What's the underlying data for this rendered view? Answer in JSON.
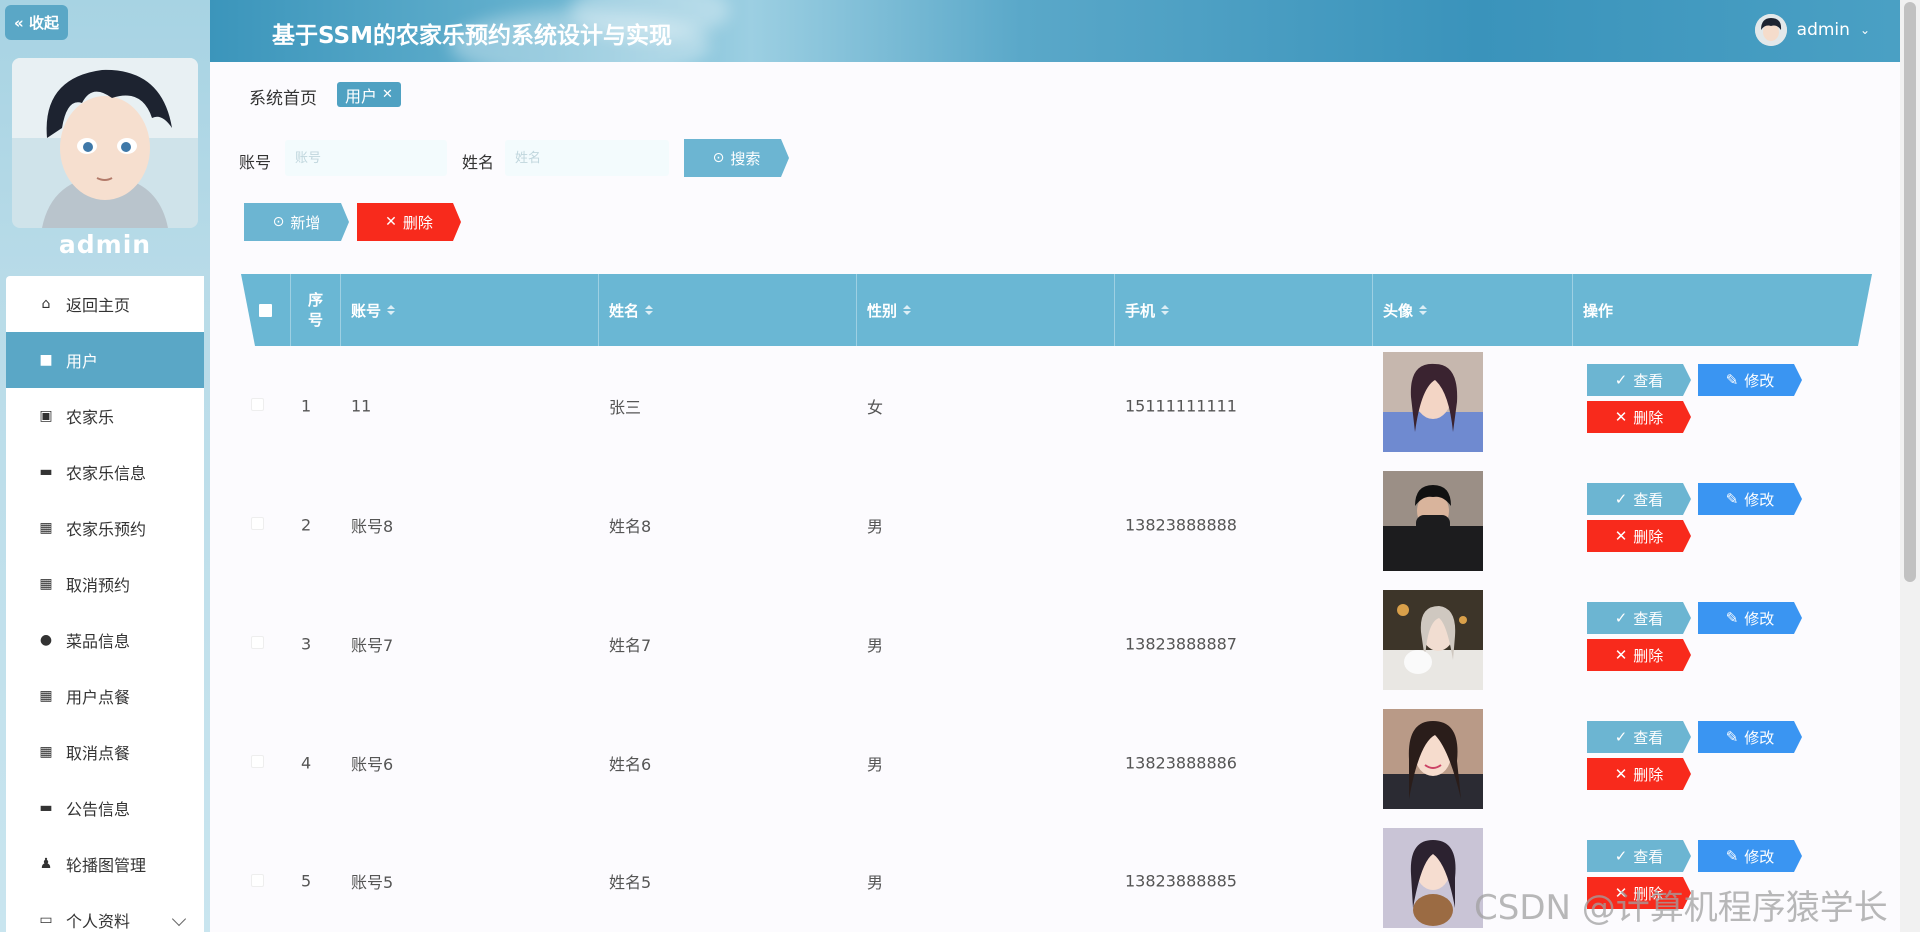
{
  "sidebar": {
    "collapse_label": "« 收起",
    "username": "admin",
    "menu": [
      {
        "label": "返回主页",
        "icon": "home-icon",
        "glyph": "⌂"
      },
      {
        "label": "用户",
        "icon": "user-thumb-icon",
        "glyph": "■"
      },
      {
        "label": "农家乐",
        "icon": "chart-icon",
        "glyph": "▣"
      },
      {
        "label": "农家乐信息",
        "icon": "monitor-icon",
        "glyph": "▬"
      },
      {
        "label": "农家乐预约",
        "icon": "grid-icon",
        "glyph": "▦"
      },
      {
        "label": "取消预约",
        "icon": "grid-icon",
        "glyph": "▦"
      },
      {
        "label": "菜品信息",
        "icon": "bulb-icon",
        "glyph": "●"
      },
      {
        "label": "用户点餐",
        "icon": "grid-icon",
        "glyph": "▦"
      },
      {
        "label": "取消点餐",
        "icon": "grid-icon",
        "glyph": "▦"
      },
      {
        "label": "公告信息",
        "icon": "printer-icon",
        "glyph": "▬"
      },
      {
        "label": "轮播图管理",
        "icon": "person-icon",
        "glyph": "♟"
      },
      {
        "label": "个人资料",
        "icon": "wallet-icon",
        "glyph": "▭"
      }
    ]
  },
  "header": {
    "title": "基于SSM的农家乐预约系统设计与实现",
    "user": "admin"
  },
  "breadcrumb": {
    "home": "系统首页",
    "current": "用户",
    "close_glyph": "✕"
  },
  "search": {
    "account_label": "账号",
    "account_placeholder": "账号",
    "name_label": "姓名",
    "name_placeholder": "姓名",
    "search_button": "搜索"
  },
  "toolbar": {
    "add_button": "新增",
    "delete_button": "删除"
  },
  "table": {
    "headers": {
      "index": "序号",
      "account": "账号",
      "name": "姓名",
      "gender": "性别",
      "phone": "手机",
      "avatar": "头像",
      "actions": "操作"
    },
    "rows": [
      {
        "index": "1",
        "account": "11",
        "name": "张三",
        "gender": "女",
        "phone": "15111111111",
        "photo": "photo-1"
      },
      {
        "index": "2",
        "account": "账号8",
        "name": "姓名8",
        "gender": "男",
        "phone": "13823888888",
        "photo": "photo-2"
      },
      {
        "index": "3",
        "account": "账号7",
        "name": "姓名7",
        "gender": "男",
        "phone": "13823888887",
        "photo": "photo-3"
      },
      {
        "index": "4",
        "account": "账号6",
        "name": "姓名6",
        "gender": "男",
        "phone": "13823888886",
        "photo": "photo-4"
      },
      {
        "index": "5",
        "account": "账号5",
        "name": "姓名5",
        "gender": "男",
        "phone": "13823888885",
        "photo": "photo-5"
      }
    ],
    "actions": {
      "view": "查看",
      "edit": "修改",
      "delete": "删除"
    }
  },
  "watermark": "CSDN @计算机程序猿学长",
  "colors": {
    "accent": "#5aa7c6",
    "header_blue": "#6ab7d4",
    "danger": "#f82a1c",
    "edit_blue": "#3a95f2"
  }
}
